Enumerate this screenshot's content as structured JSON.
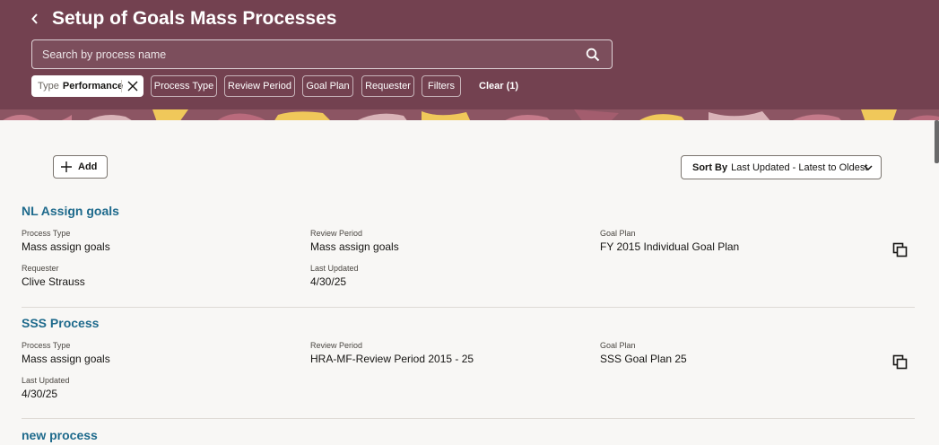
{
  "header": {
    "title": "Setup of Goals Mass Processes",
    "back_icon": "chevron-left-icon"
  },
  "search": {
    "placeholder": "Search by process name",
    "value": "",
    "icon": "search-icon"
  },
  "filters": {
    "active": {
      "label": "Type",
      "value": "Performance"
    },
    "chips": [
      "Process Type",
      "Review Period",
      "Goal Plan",
      "Requester",
      "Filters"
    ],
    "clear_label": "Clear (1)"
  },
  "toolbar": {
    "add_label": "Add",
    "sort_label": "Sort By",
    "sort_value": "Last Updated - Latest to Oldest"
  },
  "records": [
    {
      "name": "NL Assign goals",
      "process_type_label": "Process Type",
      "process_type": "Mass assign goals",
      "review_period_label": "Review Period",
      "review_period": "Mass assign goals",
      "goal_plan_label": "Goal Plan",
      "goal_plan": "FY 2015 Individual Goal Plan",
      "requester_label": "Requester",
      "requester": "Clive Strauss",
      "last_updated_label": "Last Updated",
      "last_updated": "4/30/25"
    },
    {
      "name": "SSS Process",
      "process_type_label": "Process Type",
      "process_type": "Mass assign goals",
      "review_period_label": "Review Period",
      "review_period": "HRA-MF-Review Period 2015 - 25",
      "goal_plan_label": "Goal Plan",
      "goal_plan": "SSS Goal Plan 25",
      "last_updated_label": "Last Updated",
      "last_updated": "4/30/25"
    },
    {
      "name": "new process"
    }
  ],
  "colors": {
    "header_bg": "#734150",
    "link": "#1e6a8c",
    "page_bg": "#f8f7f5"
  }
}
